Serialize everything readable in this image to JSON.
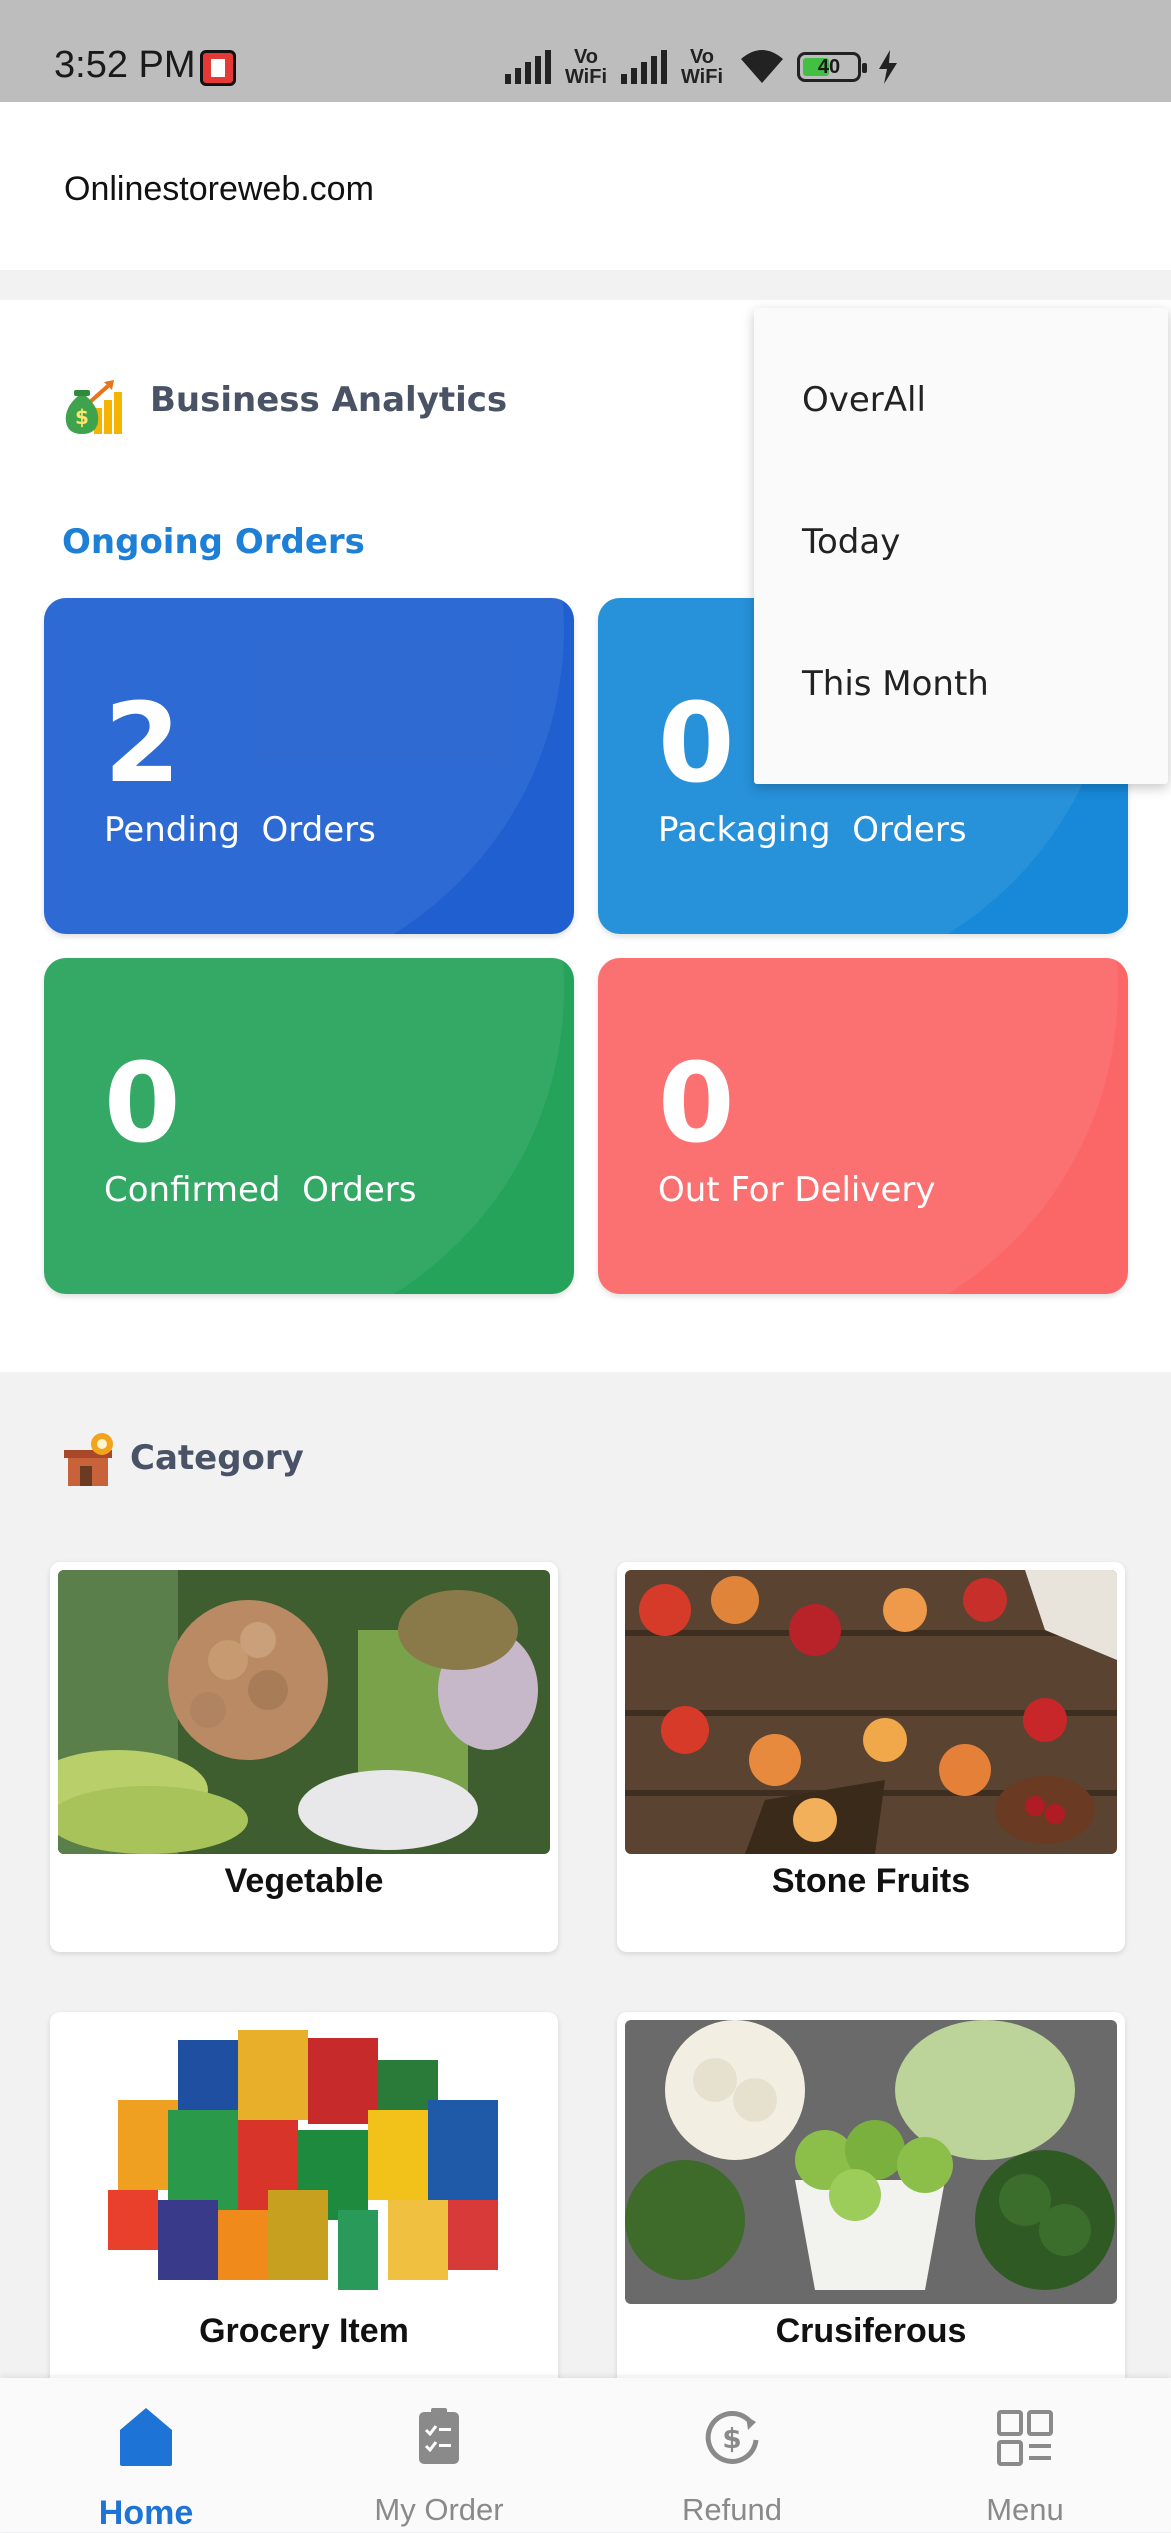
{
  "status_bar": {
    "time": "3:52 PM",
    "vowifi_1": "Vo WiFi",
    "vowifi_2": "Vo WiFi",
    "battery_level": "40",
    "icons": [
      "notification-app-icon",
      "signal-icon",
      "wifi-icon",
      "battery-icon",
      "charging-icon"
    ]
  },
  "header": {
    "site_name": "Onlinestoreweb.com"
  },
  "analytics": {
    "title": "Business Analytics",
    "icon": "money-bag-chart-icon",
    "section_label": "Ongoing Orders",
    "tiles": [
      {
        "count": "2",
        "label": "Pending  Orders",
        "color": "#1f5fd0"
      },
      {
        "count": "0",
        "label": "Packaging  Orders",
        "color": "#1789d8"
      },
      {
        "count": "0",
        "label": "Confirmed  Orders",
        "color": "#25a35a"
      },
      {
        "count": "0",
        "label": "Out For Delivery",
        "color": "#fb6666"
      }
    ]
  },
  "filter_menu": {
    "options": [
      "OverAll",
      "Today",
      "This Month"
    ]
  },
  "category": {
    "title": "Category",
    "icon": "store-category-icon",
    "items": [
      {
        "name": "Vegetable"
      },
      {
        "name": "Stone Fruits"
      },
      {
        "name": "Grocery Item"
      },
      {
        "name": "Crusiferous"
      }
    ]
  },
  "bottom_nav": {
    "active": "Home",
    "items": [
      {
        "label": "Home",
        "icon": "home-icon"
      },
      {
        "label": "My Order",
        "icon": "clipboard-icon"
      },
      {
        "label": "Refund",
        "icon": "refund-dollar-icon"
      },
      {
        "label": "Menu",
        "icon": "grid-menu-icon"
      }
    ]
  },
  "colors": {
    "accent": "#1d74d6",
    "section_title": "#4a5266",
    "ongoing_label": "#1e7fd6"
  }
}
